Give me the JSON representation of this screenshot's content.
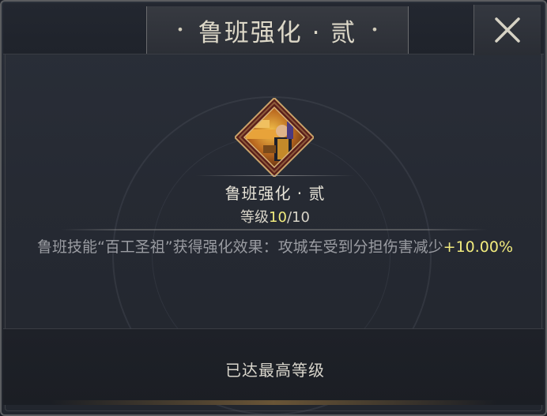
{
  "dialog": {
    "title": "鲁班强化 · 贰",
    "close_icon": "close-icon"
  },
  "skill": {
    "icon": "luban-portrait-icon",
    "name": "鲁班强化 · 贰",
    "level_label": "等级",
    "level_current": "10",
    "level_separator": "/",
    "level_max": "10",
    "description": "鲁班技能“百工圣祖”获得强化效果：攻城车受到分担伤害减少",
    "bonus": "+10.00%"
  },
  "footer": {
    "status": "已达最高等级"
  },
  "colors": {
    "highlight": "#f2ec7e",
    "text_primary": "#e8e4d8",
    "text_secondary": "#9a9ca2",
    "background": "#262a33"
  }
}
